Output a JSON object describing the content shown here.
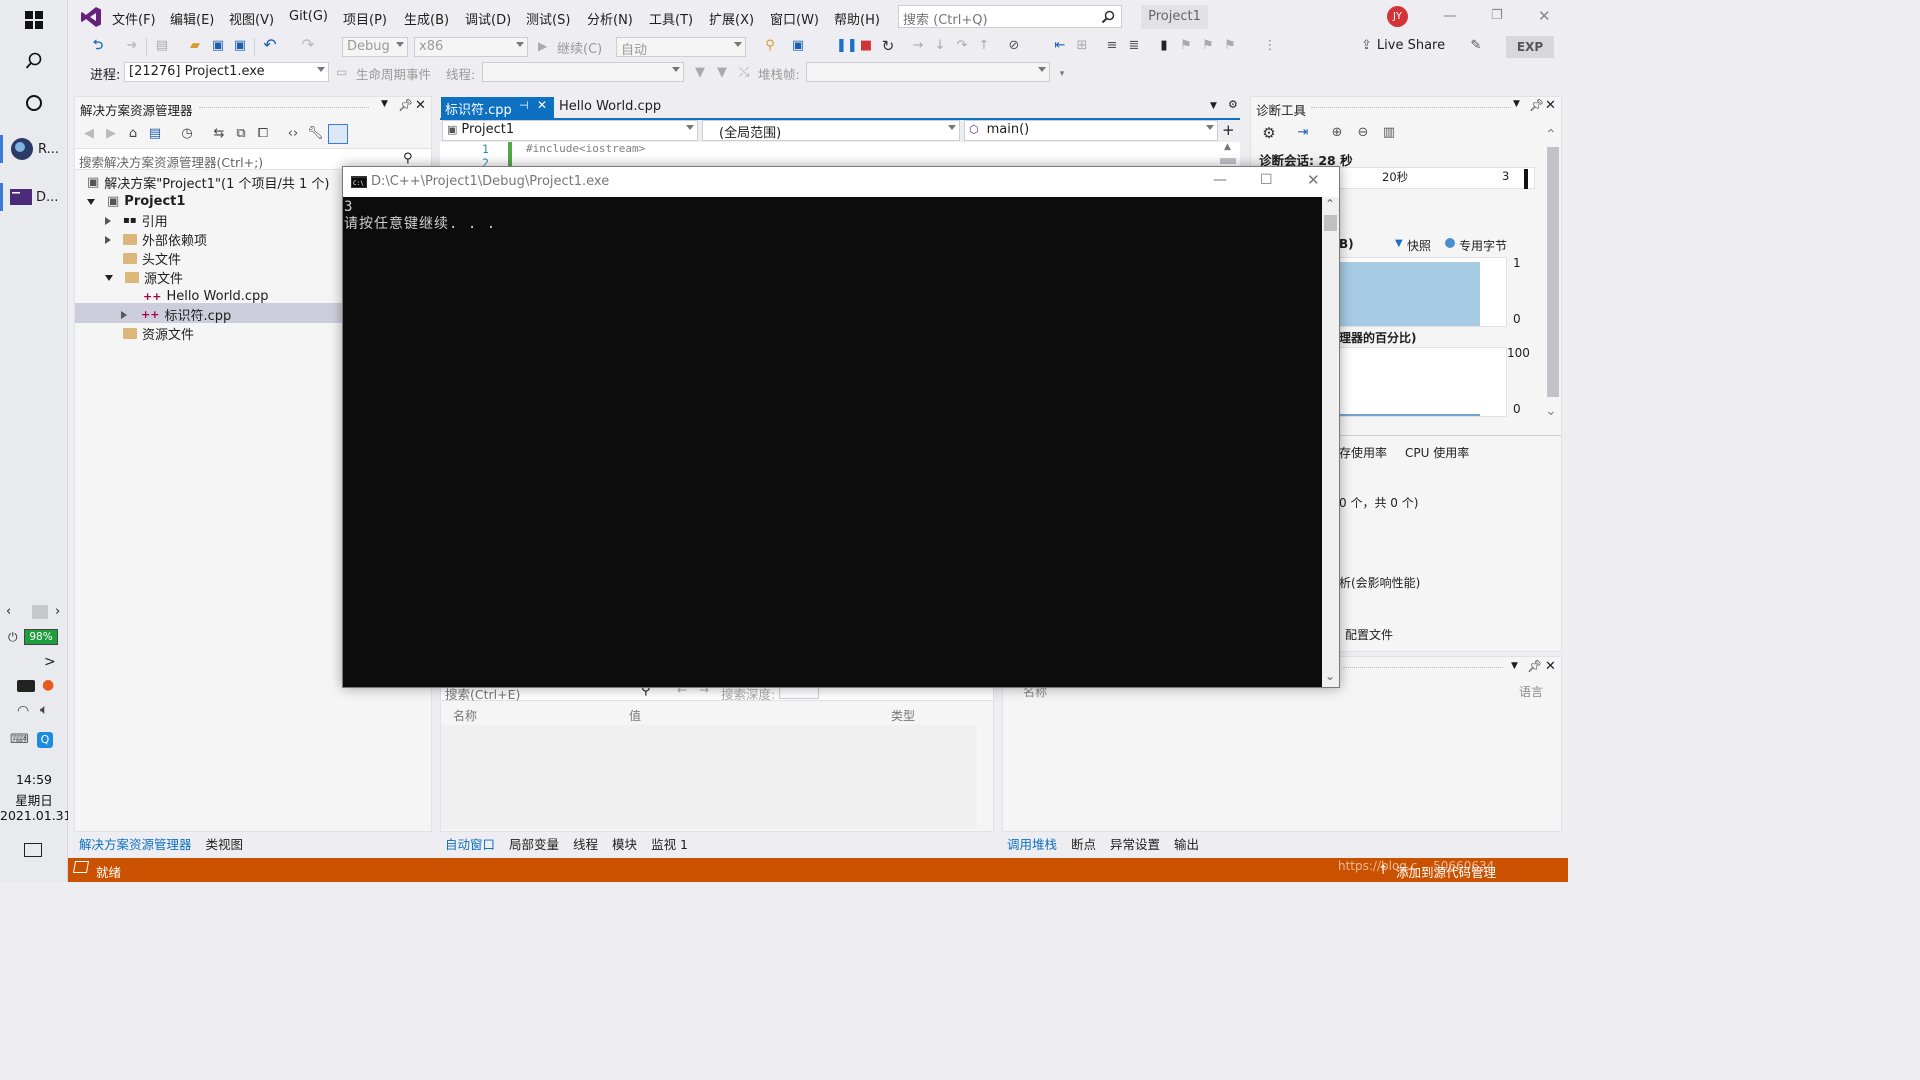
{
  "taskbar": {
    "apps": [
      {
        "label": "R..."
      },
      {
        "label": "D..."
      }
    ],
    "battery": "98%",
    "time": "14:59",
    "weekday": "星期日",
    "date": "2021.01.31"
  },
  "menu": [
    "文件(F)",
    "编辑(E)",
    "视图(V)",
    "Git(G)",
    "项目(P)",
    "生成(B)",
    "调试(D)",
    "测试(S)",
    "分析(N)",
    "工具(T)",
    "扩展(X)",
    "窗口(W)",
    "帮助(H)"
  ],
  "search": {
    "placeholder": "搜索 (Ctrl+Q)"
  },
  "solution_name": "Project1",
  "user_initials": "JY",
  "toolbar": {
    "config": "Debug",
    "platform": "x86",
    "continue": "继续(C)",
    "auto": "自动",
    "live_share": "Live Share",
    "exp": "EXP"
  },
  "debug_location": {
    "process_label": "进程:",
    "process": "[21276] Project1.exe",
    "lifecycle": "生命周期事件",
    "thread_label": "线程:",
    "stack_label": "堆栈帧:"
  },
  "solution_explorer": {
    "title": "解决方案资源管理器",
    "search_placeholder": "搜索解决方案资源管理器(Ctrl+;)",
    "solution": "解决方案\"Project1\"(1 个项目/共 1 个)",
    "project": "Project1",
    "references": "引用",
    "external_deps": "外部依赖项",
    "headers": "头文件",
    "sources": "源文件",
    "file1": "Hello World.cpp",
    "file2": "标识符.cpp",
    "resources": "资源文件",
    "bottom_tabs": [
      "解决方案资源管理器",
      "类视图"
    ]
  },
  "editor": {
    "tabs": [
      "标识符.cpp",
      "Hello World.cpp"
    ],
    "nav_project": "Project1",
    "nav_scope": "(全局范围)",
    "nav_member": "main()",
    "line1_no": "1",
    "line2_no": "2",
    "line1": "#include<iostream>"
  },
  "console": {
    "title": "D:\\C++\\Project1\\Debug\\Project1.exe",
    "output_line1": "3",
    "output_line2": "请按任意键继续. . ."
  },
  "diagnostics": {
    "title": "诊断工具",
    "session": "诊断会话: 28 秒",
    "tick_20s": "20秒",
    "tick_3": "3",
    "legend_b": "B)",
    "legend_snapshot": "快照",
    "legend_private": "专用字节",
    "mem_max": "1",
    "mem_min": "0",
    "cpu_title": "理器的百分比)",
    "cpu_max": "100",
    "cpu_min": "0",
    "tab_memory": "存使用率",
    "tab_cpu": "CPU 使用率",
    "count": "0 个，共 0 个)",
    "perf": "析(会影响性能)",
    "profile": "配置文件"
  },
  "autos": {
    "search_placeholder": "搜索(Ctrl+E)",
    "depth_label": "搜索深度:",
    "col_name": "名称",
    "col_value": "值",
    "col_type": "类型",
    "tabs": [
      "自动窗口",
      "局部变量",
      "线程",
      "模块",
      "监视 1"
    ]
  },
  "callstack": {
    "col_name": "名称",
    "col_lang": "语言",
    "tabs": [
      "调用堆栈",
      "断点",
      "异常设置",
      "输出"
    ]
  },
  "status": {
    "ready": "就绪",
    "add_source": "添加到源代码管理",
    "watermark": "https://blog.c… 50660634"
  },
  "colors": {
    "accent": "#0e70c0",
    "status_bar": "#ca5100",
    "console_bg": "#0c0c0c"
  }
}
